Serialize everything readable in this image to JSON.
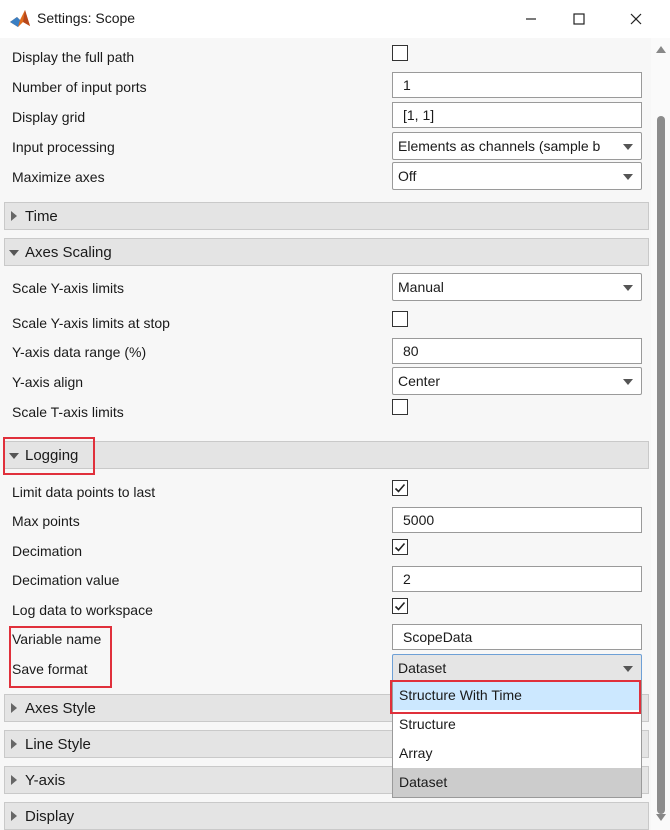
{
  "window": {
    "title": "Settings: Scope",
    "minimize_icon": "minimize-icon",
    "maximize_icon": "maximize-icon",
    "close_icon": "close-icon"
  },
  "general": {
    "display_full_path": {
      "label": "Display the full path",
      "checked": false
    },
    "num_input_ports": {
      "label": "Number of input ports",
      "value": "1"
    },
    "display_grid": {
      "label": "Display grid",
      "value": "[1, 1]"
    },
    "input_processing": {
      "label": "Input processing",
      "value": "Elements as channels (sample b"
    },
    "maximize_axes": {
      "label": "Maximize axes",
      "value": "Off"
    }
  },
  "sections": {
    "time": "Time",
    "axes_scaling": "Axes Scaling",
    "logging": "Logging",
    "axes_style": "Axes Style",
    "line_style": "Line Style",
    "y_axis": "Y-axis",
    "display": "Display"
  },
  "axes_scaling": {
    "scale_y_limits": {
      "label": "Scale Y-axis limits",
      "value": "Manual"
    },
    "scale_y_at_stop": {
      "label": "Scale Y-axis limits at stop",
      "checked": false
    },
    "y_data_range": {
      "label": "Y-axis data range (%)",
      "value": "80"
    },
    "y_align": {
      "label": "Y-axis align",
      "value": "Center"
    },
    "scale_t_limits": {
      "label": "Scale T-axis limits",
      "checked": false
    }
  },
  "logging": {
    "limit_points": {
      "label": "Limit data points to last",
      "checked": true
    },
    "max_points": {
      "label": "Max points",
      "value": "5000"
    },
    "decimation": {
      "label": "Decimation",
      "checked": true
    },
    "decimation_value": {
      "label": "Decimation value",
      "value": "2"
    },
    "log_to_workspace": {
      "label": "Log data to workspace",
      "checked": true
    },
    "variable_name": {
      "label": "Variable name",
      "value": "ScopeData"
    },
    "save_format": {
      "label": "Save format",
      "value": "Dataset"
    }
  },
  "save_format_options": [
    "Structure With Time",
    "Structure",
    "Array",
    "Dataset"
  ],
  "colors": {
    "highlight_box": "#e0303b",
    "option_hover": "#cce8ff",
    "option_selected": "#cccccc",
    "section_bg": "#e4e4e4"
  }
}
